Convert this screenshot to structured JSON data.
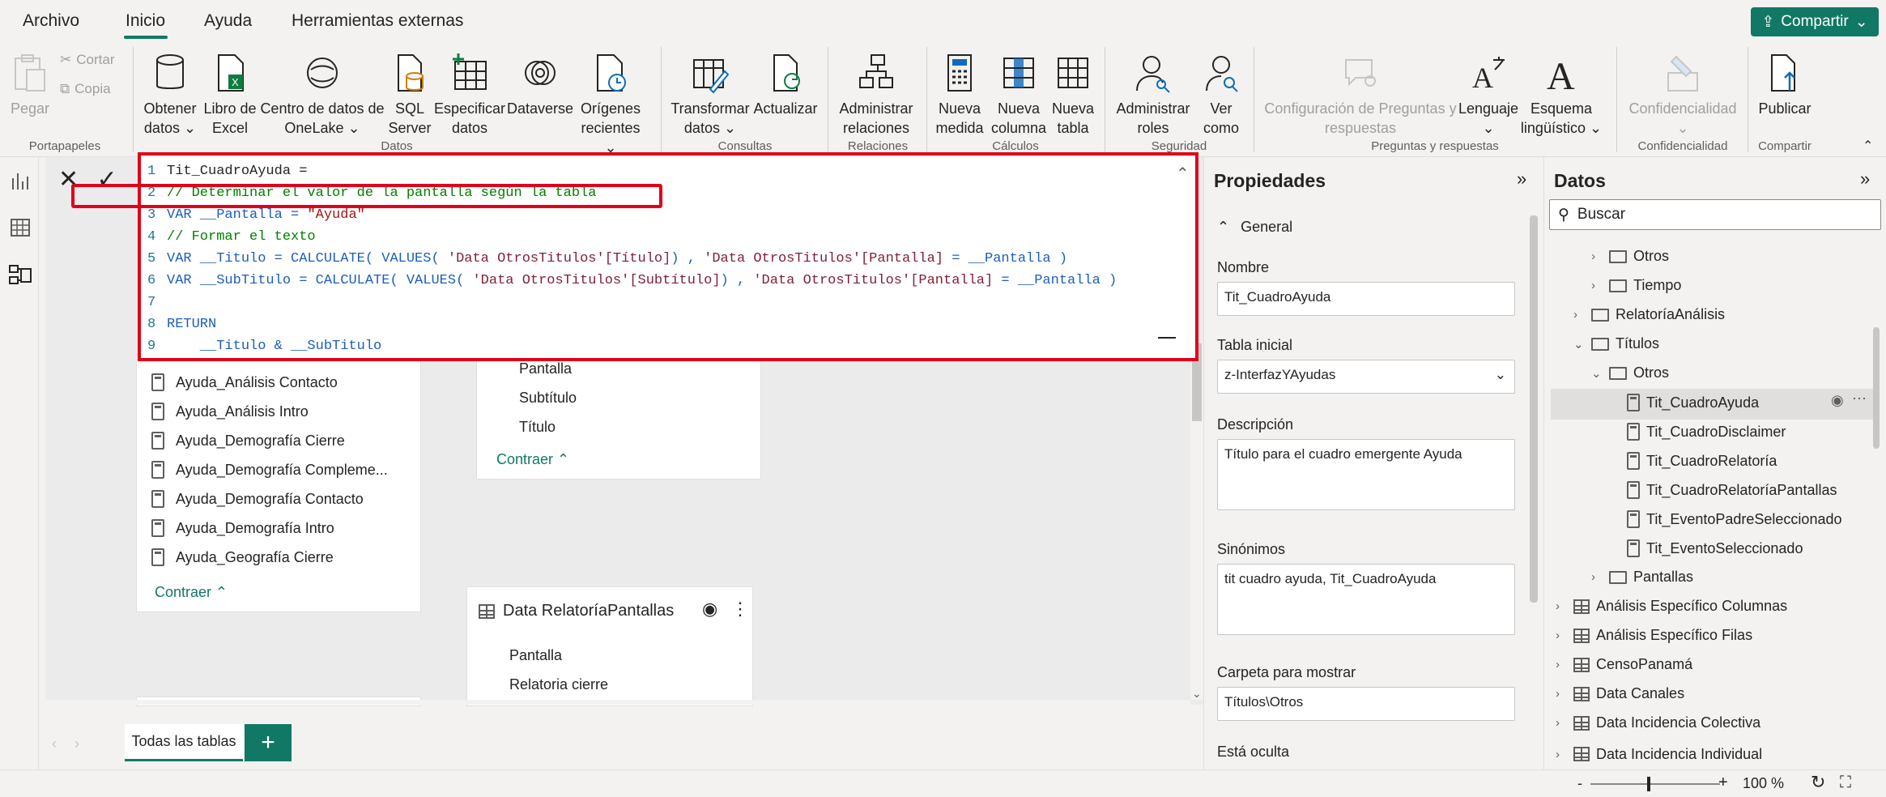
{
  "menu": {
    "tabs": [
      "Archivo",
      "Inicio",
      "Ayuda",
      "Herramientas externas"
    ],
    "share": "Compartir"
  },
  "ribbon": {
    "portapapeles": {
      "pegar": "Pegar",
      "cortar": "Cortar",
      "copia": "Copia",
      "group": "Portapapeles"
    },
    "datos": {
      "obtener1": "Obtener",
      "obtener2": "datos",
      "libro1": "Libro de",
      "libro2": "Excel",
      "centro1": "Centro de datos de",
      "centro2": "OneLake",
      "sql1": "SQL",
      "sql2": "Server",
      "esp1": "Especificar",
      "esp2": "datos",
      "dataverse": "Dataverse",
      "orig1": "Orígenes",
      "orig2": "recientes",
      "group": "Datos"
    },
    "consultas": {
      "trans1": "Transformar",
      "trans2": "datos",
      "actualizar": "Actualizar",
      "group": "Consultas"
    },
    "relaciones": {
      "adm1": "Administrar",
      "adm2": "relaciones",
      "group": "Relaciones"
    },
    "calculos": {
      "nm1": "Nueva",
      "nm2": "medida",
      "nc1": "Nueva",
      "nc2": "columna",
      "nt1": "Nueva",
      "nt2": "tabla",
      "group": "Cálculos"
    },
    "seguridad": {
      "ar1": "Administrar",
      "ar2": "roles",
      "vc1": "Ver",
      "vc2": "como",
      "group": "Seguridad"
    },
    "preguntas": {
      "conf1": "Configuración de Preguntas y",
      "conf2": "respuestas",
      "leng": "Lenguaje",
      "esq1": "Esquema",
      "esq2": "lingüístico",
      "group": "Preguntas y respuestas"
    },
    "confidencialidad": {
      "label": "Confidencialidad",
      "group": "Confidencialidad"
    },
    "compartir": {
      "publicar": "Publicar",
      "group": "Compartir"
    }
  },
  "editor": {
    "lines": [
      {
        "n": "1",
        "t": "Tit_CuadroAyuda ="
      },
      {
        "n": "2",
        "t": "// Determinar el valor de la pantalla según la tabla"
      },
      {
        "n": "3",
        "a": "VAR",
        "b": " __Pantalla = ",
        "c": "\"Ayuda\""
      },
      {
        "n": "4",
        "t": "// Formar el texto"
      },
      {
        "n": "5",
        "a": "VAR",
        "b": " __Titulo = ",
        "c": "CALCULATE( VALUES( ",
        "d": "'Data OtrosTitulos'[Título]",
        "e": ") , ",
        "f": "'Data OtrosTitulos'[Pantalla]",
        "g": " = __Pantalla )"
      },
      {
        "n": "6",
        "a": "VAR",
        "b": " __SubTitulo = ",
        "c": "CALCULATE( VALUES( ",
        "d": "'Data OtrosTitulos'[Subtítulo]",
        "e": ") , ",
        "f": "'Data OtrosTitulos'[Pantalla]",
        "g": " = __Pantalla )"
      },
      {
        "n": "7",
        "t": ""
      },
      {
        "n": "8",
        "t": "RETURN"
      },
      {
        "n": "9",
        "t": "    __Titulo & __SubTitulo"
      }
    ]
  },
  "canvas": {
    "card1": {
      "items": [
        "Ayuda_Análisis Contacto",
        "Ayuda_Análisis Intro",
        "Ayuda_Demografía Cierre",
        "Ayuda_Demografía Compleme...",
        "Ayuda_Demografía Contacto",
        "Ayuda_Demografía Intro",
        "Ayuda_Geografía Cierre"
      ],
      "contraer": "Contraer"
    },
    "card2": {
      "items": [
        "Pantalla",
        "Subtítulo",
        "Título"
      ],
      "contraer": "Contraer"
    },
    "card3": {
      "title": "Data RelatoríaPantallas",
      "items": [
        "Pantalla",
        "Relatoria cierre"
      ]
    }
  },
  "tabs": {
    "all": "Todas las tablas",
    "add": "+"
  },
  "properties": {
    "title": "Propiedades",
    "section": "General",
    "nombre_label": "Nombre",
    "nombre": "Tit_CuadroAyuda",
    "tabla_label": "Tabla inicial",
    "tabla": "z-InterfazYAyudas",
    "desc_label": "Descripción",
    "desc": "Título para el cuadro emergente Ayuda",
    "sin_label": "Sinónimos",
    "sin": "tit cuadro ayuda, Tit_CuadroAyuda",
    "carpeta_label": "Carpeta para mostrar",
    "carpeta": "Títulos\\Otros",
    "oculta_label": "Está oculta"
  },
  "data": {
    "title": "Datos",
    "search": "Buscar",
    "tree": [
      "Otros",
      "Tiempo",
      "RelatoríaAnálisis",
      "Títulos",
      "Otros",
      "Tit_CuadroAyuda",
      "Tit_CuadroDisclaimer",
      "Tit_CuadroRelatoría",
      "Tit_CuadroRelatoríaPantallas",
      "Tit_EventoPadreSeleccionado",
      "Tit_EventoSeleccionado",
      "Pantallas",
      "Análisis Específico Columnas",
      "Análisis Específico Filas",
      "CensoPanamá",
      "Data Canales",
      "Data Incidencia Colectiva",
      "Data Incidencia Individual"
    ]
  },
  "status": {
    "zoom": "100 %",
    "minus": "-",
    "plus": "+"
  }
}
